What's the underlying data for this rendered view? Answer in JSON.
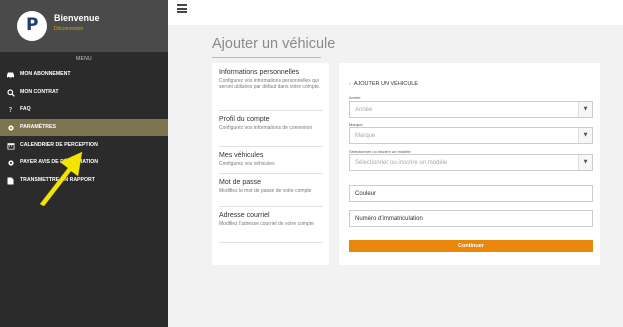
{
  "brand": {
    "title": "Bienvenue",
    "subtitle": "Déconnexion"
  },
  "sidebar": {
    "heading": "MENU",
    "active_color": "#7c734f",
    "items": [
      {
        "label": "MON ABONNEMENT",
        "icon": "car-icon"
      },
      {
        "label": "MON CONTRAT",
        "icon": "search-icon"
      },
      {
        "label": "FAQ",
        "icon": "question-icon"
      },
      {
        "label": "PARAMÈTRES",
        "icon": "gear-icon",
        "active": true
      },
      {
        "label": "CALENDRIER DE PERCEPTION",
        "icon": "calendar-icon"
      },
      {
        "label": "PAYER AVIS DE RÉCLAMATION",
        "icon": "gear-icon"
      },
      {
        "label": "TRANSMETTRE UN RAPPORT",
        "icon": "document-icon"
      }
    ]
  },
  "page": {
    "title": "Ajouter un véhicule"
  },
  "account_menu": [
    {
      "title": "Informations personnelles",
      "desc": "Configurez vos informations personnelles qui seront utilisées par défaut dans votre compte."
    },
    {
      "title": "Profil du compte",
      "desc": "Configurez vos informations de connexion"
    },
    {
      "title": "Mes véhicules",
      "desc": "Configurez vos véhicules"
    },
    {
      "title": "Mot de passe",
      "desc": "Modifiez le mot de passe de votre compte"
    },
    {
      "title": "Adresse courriel",
      "desc": "Modifiez l'adresse courriel de votre compte"
    }
  ],
  "form": {
    "back_label": "AJOUTER UN VÉHICULE",
    "year": {
      "label": "Année",
      "placeholder": "Année"
    },
    "make": {
      "label": "Marque",
      "placeholder": "Marque"
    },
    "model": {
      "label": "Sélectionner ou inscrire un modèle",
      "placeholder": "Sélectionner ou inscrire un modèle"
    },
    "color": {
      "placeholder": "Couleur"
    },
    "plate": {
      "placeholder": "Numéro d'immatriculation"
    },
    "submit_label": "Continuer",
    "accent_color": "#e8870a"
  }
}
